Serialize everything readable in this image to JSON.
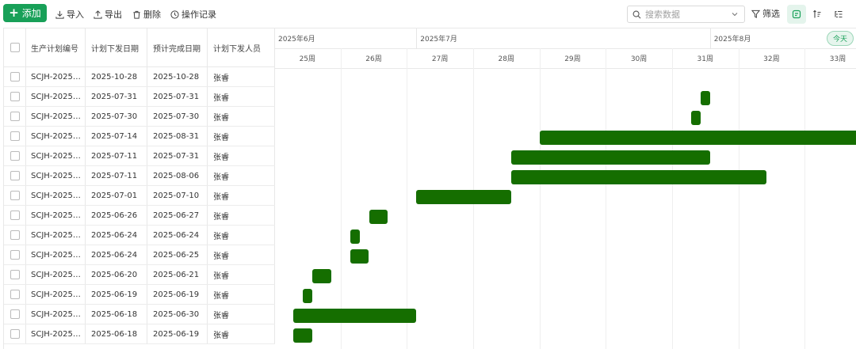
{
  "toolbar": {
    "add_label": "添加",
    "import_label": "导入",
    "export_label": "导出",
    "delete_label": "删除",
    "log_label": "操作记录",
    "search_placeholder": "搜索数据",
    "filter_label": "筛选",
    "today_label": "今天"
  },
  "table": {
    "columns": [
      "生产计划编号",
      "计划下发日期",
      "预计完成日期",
      "计划下发人员"
    ],
    "rows": [
      {
        "code": "SCJH-20251...",
        "issue": "2025-10-28",
        "finish": "2025-10-28",
        "person": "张睿"
      },
      {
        "code": "SCJH-20250...",
        "issue": "2025-07-31",
        "finish": "2025-07-31",
        "person": "张睿"
      },
      {
        "code": "SCJH-20250...",
        "issue": "2025-07-30",
        "finish": "2025-07-30",
        "person": "张睿"
      },
      {
        "code": "SCJH-20250...",
        "issue": "2025-07-14",
        "finish": "2025-08-31",
        "person": "张睿"
      },
      {
        "code": "SCJH-20250...",
        "issue": "2025-07-11",
        "finish": "2025-07-31",
        "person": "张睿"
      },
      {
        "code": "SCJH-20250...",
        "issue": "2025-07-11",
        "finish": "2025-08-06",
        "person": "张睿"
      },
      {
        "code": "SCJH-20250...",
        "issue": "2025-07-01",
        "finish": "2025-07-10",
        "person": "张睿"
      },
      {
        "code": "SCJH-20250...",
        "issue": "2025-06-26",
        "finish": "2025-06-27",
        "person": "张睿"
      },
      {
        "code": "SCJH-20250...",
        "issue": "2025-06-24",
        "finish": "2025-06-24",
        "person": "张睿"
      },
      {
        "code": "SCJH-20250...",
        "issue": "2025-06-24",
        "finish": "2025-06-25",
        "person": "张睿"
      },
      {
        "code": "SCJH-20250...",
        "issue": "2025-06-20",
        "finish": "2025-06-21",
        "person": "张睿"
      },
      {
        "code": "SCJH-20250...",
        "issue": "2025-06-19",
        "finish": "2025-06-19",
        "person": "张睿"
      },
      {
        "code": "SCJH-20250...",
        "issue": "2025-06-18",
        "finish": "2025-06-30",
        "person": "张睿"
      },
      {
        "code": "SCJH-20250...",
        "issue": "2025-06-18",
        "finish": "2025-06-19",
        "person": "张睿"
      }
    ]
  },
  "gantt": {
    "months": [
      "2025年6月",
      "2025年7月",
      "2025年8月"
    ],
    "weeks": [
      "25周",
      "26周",
      "27周",
      "28周",
      "29周",
      "30周",
      "31周",
      "32周",
      "33周"
    ],
    "bar_color": "#156e00"
  },
  "colors": {
    "accent": "#18a058",
    "bar": "#156e00"
  },
  "icons": {
    "add": "plus-icon",
    "import": "download-icon",
    "export": "upload-icon",
    "delete": "trash-icon",
    "log": "clock-icon",
    "search": "search-icon",
    "filter": "funnel-icon",
    "gantt_view": "gantt-icon",
    "sort": "sort-icon",
    "list": "list-icon"
  }
}
